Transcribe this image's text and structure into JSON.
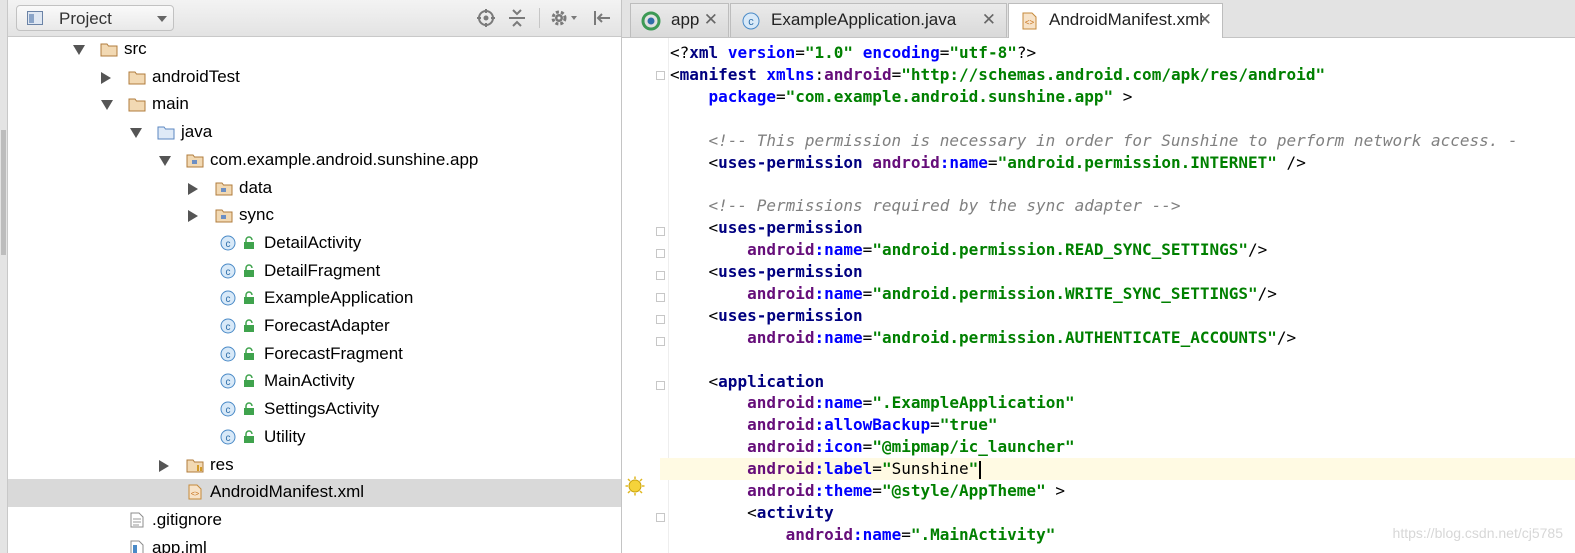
{
  "project_panel": {
    "view_selector": "Project",
    "header_icons": [
      "locate-icon",
      "collapse-all-icon",
      "settings-gear-icon",
      "hide-panel-icon"
    ],
    "tree": [
      {
        "label": "src",
        "icon": "folder-icon",
        "depth": 0,
        "expanded": true
      },
      {
        "label": "androidTest",
        "icon": "folder-icon",
        "depth": 1,
        "expanded": false
      },
      {
        "label": "main",
        "icon": "folder-icon",
        "depth": 1,
        "expanded": true
      },
      {
        "label": "java",
        "icon": "source-folder-icon",
        "depth": 2,
        "expanded": true
      },
      {
        "label": "com.example.android.sunshine.app",
        "icon": "package-icon",
        "depth": 3,
        "expanded": true
      },
      {
        "label": "data",
        "icon": "package-icon",
        "depth": 4,
        "expanded": false
      },
      {
        "label": "sync",
        "icon": "package-icon",
        "depth": 4,
        "expanded": false
      },
      {
        "label": "DetailActivity",
        "icon": "class-icon",
        "depth": 5
      },
      {
        "label": "DetailFragment",
        "icon": "class-icon",
        "depth": 5
      },
      {
        "label": "ExampleApplication",
        "icon": "class-icon",
        "depth": 5
      },
      {
        "label": "ForecastAdapter",
        "icon": "class-icon",
        "depth": 5
      },
      {
        "label": "ForecastFragment",
        "icon": "class-icon",
        "depth": 5
      },
      {
        "label": "MainActivity",
        "icon": "class-icon",
        "depth": 5
      },
      {
        "label": "SettingsActivity",
        "icon": "class-icon",
        "depth": 5
      },
      {
        "label": "Utility",
        "icon": "class-icon",
        "depth": 5
      },
      {
        "label": "res",
        "icon": "resource-folder-icon",
        "depth": 3,
        "expanded": false
      },
      {
        "label": "AndroidManifest.xml",
        "icon": "xml-file-icon",
        "depth": 3,
        "selected": true
      },
      {
        "label": ".gitignore",
        "icon": "text-file-icon",
        "depth": 1
      },
      {
        "label": "app.iml",
        "icon": "module-file-icon",
        "depth": 1
      }
    ]
  },
  "editor": {
    "tabs": [
      {
        "label": "app",
        "icon": "gradle-module-icon",
        "active": false
      },
      {
        "label": "ExampleApplication.java",
        "icon": "class-icon",
        "active": false
      },
      {
        "label": "AndroidManifest.xml",
        "icon": "xml-file-icon",
        "active": true
      }
    ],
    "close_glyph": "✕",
    "code_lines": [
      {
        "tokens": [
          [
            "plain",
            "<?"
          ],
          [
            "tag",
            "xml"
          ],
          [
            "plain",
            " "
          ],
          [
            "attr",
            "version"
          ],
          [
            "plain",
            "="
          ],
          [
            "val",
            "\"1.0\""
          ],
          [
            "plain",
            " "
          ],
          [
            "attr",
            "encoding"
          ],
          [
            "plain",
            "="
          ],
          [
            "val",
            "\"utf-8\""
          ],
          [
            "plain",
            "?>"
          ]
        ]
      },
      {
        "tokens": [
          [
            "plain",
            "<"
          ],
          [
            "tag",
            "manifest"
          ],
          [
            "plain",
            " "
          ],
          [
            "attr",
            "xmlns"
          ],
          [
            "plain",
            ":"
          ],
          [
            "ns",
            "android"
          ],
          [
            "plain",
            "="
          ],
          [
            "val",
            "\"http://schemas.android.com/apk/res/android\""
          ]
        ]
      },
      {
        "tokens": [
          [
            "plain",
            "    "
          ],
          [
            "attr",
            "package"
          ],
          [
            "plain",
            "="
          ],
          [
            "val",
            "\"com.example.android.sunshine.app\""
          ],
          [
            "plain",
            " >"
          ]
        ]
      },
      {
        "tokens": []
      },
      {
        "tokens": [
          [
            "plain",
            "    "
          ],
          [
            "comment",
            "<!-- This permission is necessary in order for Sunshine to perform network access. -"
          ]
        ]
      },
      {
        "tokens": [
          [
            "plain",
            "    <"
          ],
          [
            "tag",
            "uses-permission"
          ],
          [
            "plain",
            " "
          ],
          [
            "ns",
            "android"
          ],
          [
            "attr",
            ":name"
          ],
          [
            "plain",
            "="
          ],
          [
            "val",
            "\"android.permission.INTERNET\""
          ],
          [
            "plain",
            " />"
          ]
        ]
      },
      {
        "tokens": []
      },
      {
        "tokens": [
          [
            "plain",
            "    "
          ],
          [
            "comment",
            "<!-- Permissions required by the sync adapter -->"
          ]
        ]
      },
      {
        "tokens": [
          [
            "plain",
            "    <"
          ],
          [
            "tag",
            "uses-permission"
          ]
        ]
      },
      {
        "tokens": [
          [
            "plain",
            "        "
          ],
          [
            "ns",
            "android"
          ],
          [
            "attr",
            ":name"
          ],
          [
            "plain",
            "="
          ],
          [
            "val",
            "\"android.permission.READ_SYNC_SETTINGS\""
          ],
          [
            "plain",
            "/>"
          ]
        ]
      },
      {
        "tokens": [
          [
            "plain",
            "    <"
          ],
          [
            "tag",
            "uses-permission"
          ]
        ]
      },
      {
        "tokens": [
          [
            "plain",
            "        "
          ],
          [
            "ns",
            "android"
          ],
          [
            "attr",
            ":name"
          ],
          [
            "plain",
            "="
          ],
          [
            "val",
            "\"android.permission.WRITE_SYNC_SETTINGS\""
          ],
          [
            "plain",
            "/>"
          ]
        ]
      },
      {
        "tokens": [
          [
            "plain",
            "    <"
          ],
          [
            "tag",
            "uses-permission"
          ]
        ]
      },
      {
        "tokens": [
          [
            "plain",
            "        "
          ],
          [
            "ns",
            "android"
          ],
          [
            "attr",
            ":name"
          ],
          [
            "plain",
            "="
          ],
          [
            "val",
            "\"android.permission.AUTHENTICATE_ACCOUNTS\""
          ],
          [
            "plain",
            "/>"
          ]
        ]
      },
      {
        "tokens": []
      },
      {
        "tokens": [
          [
            "plain",
            "    <"
          ],
          [
            "tag",
            "application"
          ]
        ]
      },
      {
        "tokens": [
          [
            "plain",
            "        "
          ],
          [
            "ns",
            "android"
          ],
          [
            "attr",
            ":name"
          ],
          [
            "plain",
            "="
          ],
          [
            "val",
            "\".ExampleApplication\""
          ]
        ]
      },
      {
        "tokens": [
          [
            "plain",
            "        "
          ],
          [
            "ns",
            "android"
          ],
          [
            "attr",
            ":allowBackup"
          ],
          [
            "plain",
            "="
          ],
          [
            "val",
            "\"true\""
          ]
        ]
      },
      {
        "tokens": [
          [
            "plain",
            "        "
          ],
          [
            "ns",
            "android"
          ],
          [
            "attr",
            ":icon"
          ],
          [
            "plain",
            "="
          ],
          [
            "val",
            "\"@mipmap/ic_launcher\""
          ]
        ]
      },
      {
        "tokens": [
          [
            "plain",
            "        "
          ],
          [
            "ns",
            "android"
          ],
          [
            "attr",
            ":label"
          ],
          [
            "plain",
            "="
          ],
          [
            "val",
            "\""
          ],
          [
            "plain",
            "Sunshine"
          ],
          [
            "val",
            "\""
          ]
        ],
        "caret": true
      },
      {
        "tokens": [
          [
            "plain",
            "        "
          ],
          [
            "ns",
            "android"
          ],
          [
            "attr",
            ":theme"
          ],
          [
            "plain",
            "="
          ],
          [
            "val",
            "\"@style/AppTheme\""
          ],
          [
            "plain",
            " >"
          ]
        ]
      },
      {
        "tokens": [
          [
            "plain",
            "        <"
          ],
          [
            "tag",
            "activity"
          ]
        ]
      },
      {
        "tokens": [
          [
            "plain",
            "            "
          ],
          [
            "ns",
            "android"
          ],
          [
            "attr",
            ":name"
          ],
          [
            "plain",
            "="
          ],
          [
            "val",
            "\".MainActivity\""
          ]
        ]
      }
    ],
    "watermark": "https://blog.csdn.net/cj5785"
  }
}
